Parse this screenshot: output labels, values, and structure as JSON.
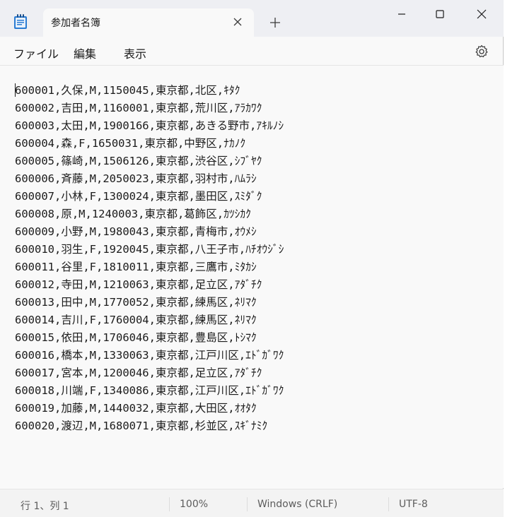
{
  "tab": {
    "title": "参加者名簿"
  },
  "menu": {
    "file": "ファイル",
    "edit": "編集",
    "view": "表示"
  },
  "editor": {
    "lines": [
      "600001,久保,M,1150045,東京都,北区,ｷﾀｸ",
      "600002,吉田,M,1160001,東京都,荒川区,ｱﾗｶﾜｸ",
      "600003,太田,M,1900166,東京都,あきる野市,ｱｷﾙﾉｼ",
      "600004,森,F,1650031,東京都,中野区,ﾅｶﾉｸ",
      "600005,篠崎,M,1506126,東京都,渋谷区,ｼﾌﾞﾔｸ",
      "600006,斉藤,M,2050023,東京都,羽村市,ﾊﾑﾗｼ",
      "600007,小林,F,1300024,東京都,墨田区,ｽﾐﾀﾞｸ",
      "600008,原,M,1240003,東京都,葛飾区,ｶﾂｼｶｸ",
      "600009,小野,M,1980043,東京都,青梅市,ｵｳﾒｼ",
      "600010,羽生,F,1920045,東京都,八王子市,ﾊﾁｵｳｼﾞｼ",
      "600011,谷里,F,1810011,東京都,三鷹市,ﾐﾀｶｼ",
      "600012,寺田,M,1210063,東京都,足立区,ｱﾀﾞﾁｸ",
      "600013,田中,M,1770052,東京都,練馬区,ﾈﾘﾏｸ",
      "600014,吉川,F,1760004,東京都,練馬区,ﾈﾘﾏｸ",
      "600015,依田,M,1706046,東京都,豊島区,ﾄｼﾏｸ",
      "600016,橋本,M,1330063,東京都,江戸川区,ｴﾄﾞｶﾞﾜｸ",
      "600017,宮本,M,1200046,東京都,足立区,ｱﾀﾞﾁｸ",
      "600018,川端,F,1340086,東京都,江戸川区,ｴﾄﾞｶﾞﾜｸ",
      "600019,加藤,M,1440032,東京都,大田区,ｵｵﾀｸ",
      "600020,渡辺,M,1680071,東京都,杉並区,ｽｷﾞﾅﾐｸ"
    ]
  },
  "status": {
    "position": "行 1、列 1",
    "zoom": "100%",
    "line_ending": "Windows (CRLF)",
    "encoding": "UTF-8"
  },
  "icons": {
    "app": "notepad-icon",
    "close_tab": "close-icon",
    "new_tab": "plus-icon",
    "minimize": "minimize-icon",
    "maximize": "maximize-icon",
    "close_window": "close-icon",
    "settings": "gear-icon"
  },
  "colors": {
    "accent": "#1e6fc4",
    "titlebar": "#eeeff3",
    "editor_bg": "#f9f9f9"
  }
}
